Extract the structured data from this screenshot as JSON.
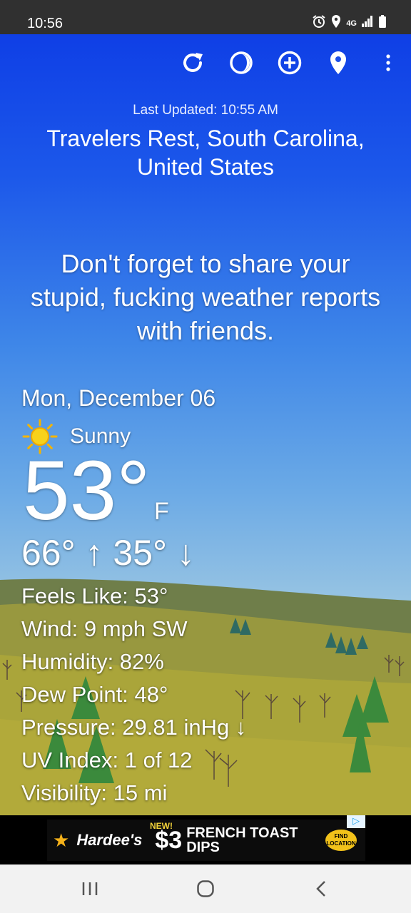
{
  "status_bar": {
    "time": "10:56",
    "icons": [
      "alarm-icon",
      "location-icon",
      "4g-lte-icon",
      "signal-icon",
      "battery-icon"
    ],
    "network": "4G"
  },
  "toolbar": {
    "buttons": [
      "refresh-icon",
      "theme-icon",
      "add-location-icon",
      "pin-location-icon",
      "more-options-icon"
    ]
  },
  "header": {
    "last_updated": "Last Updated: 10:55 AM",
    "location": "Travelers Rest, South Carolina, United States"
  },
  "quote": "Don't forget to share your stupid, fucking weather reports with friends.",
  "current": {
    "date": "Mon, December 06",
    "condition": "Sunny",
    "temperature": "53°",
    "unit": "F",
    "high_low": "66° ↑ 35° ↓"
  },
  "details": {
    "feels_like": "Feels Like:  53°",
    "wind": "Wind:  9 mph SW",
    "humidity": "Humidity:  82%",
    "dew_point": "Dew Point:  48°",
    "pressure": "Pressure:  29.81 inHg ↓",
    "uv_index": "UV Index:  1 of 12",
    "visibility": "Visibility:  15 mi"
  },
  "ad": {
    "brand": "Hardee's",
    "badge": "NEW!",
    "price": "$3",
    "product_line1": "FRENCH TOAST",
    "product_line2": "DIPS",
    "cta": "FIND LOCATION"
  },
  "colors": {
    "sky_top": "#0f3fe6",
    "sky_bottom": "#a8cfe2",
    "hill_far": "#6f7e4a",
    "hill_near": "#a8a43a",
    "status_bar": "#303030"
  }
}
